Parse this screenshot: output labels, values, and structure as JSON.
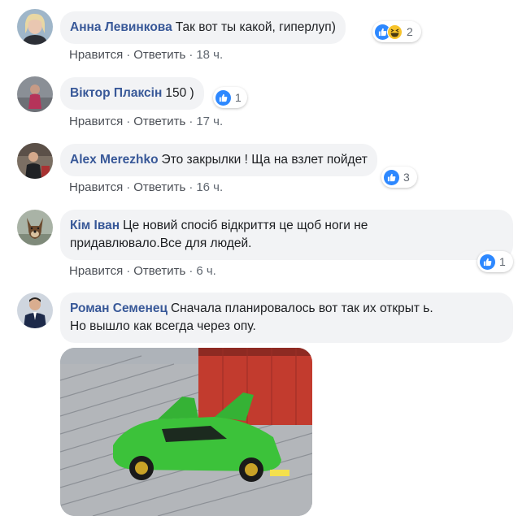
{
  "comments": [
    {
      "author": "Анна Левинкова",
      "text": "Так вот ты какой, гиперлуп)",
      "like": "Нравится",
      "reply": "Ответить",
      "time": "18 ч.",
      "reaction_count": "2",
      "reactions": [
        "like-icon",
        "haha-icon"
      ]
    },
    {
      "author": "Віктор Плаксін",
      "text": "150 )",
      "like": "Нравится",
      "reply": "Ответить",
      "time": "17 ч.",
      "reaction_count": "1",
      "reactions": [
        "like-icon"
      ]
    },
    {
      "author": "Alex Merezhko",
      "text": "Это закрылки ! Ща на взлет пойдет",
      "like": "Нравится",
      "reply": "Ответить",
      "time": "16 ч.",
      "reaction_count": "3",
      "reactions": [
        "like-icon"
      ]
    },
    {
      "author": "Кім Іван",
      "text": "Це новий спосіб відкриття це щоб ноги не",
      "text2": "придавлювало.Все для людей.",
      "like": "Нравится",
      "reply": "Ответить",
      "time": "6 ч.",
      "reaction_count": "1",
      "reactions": [
        "like-icon"
      ]
    },
    {
      "author": "Роман Семенец",
      "text": "Сначала планировалось вот так их открыт ь.",
      "text2": "Но вышло как всегда через опу.",
      "image": "green-supercar-photo"
    }
  ],
  "separator": "·",
  "colors": {
    "author": "#385898",
    "bubble": "#f2f3f5",
    "like_blue": "#2d88ff",
    "haha_yellow": "#f7c32a"
  }
}
